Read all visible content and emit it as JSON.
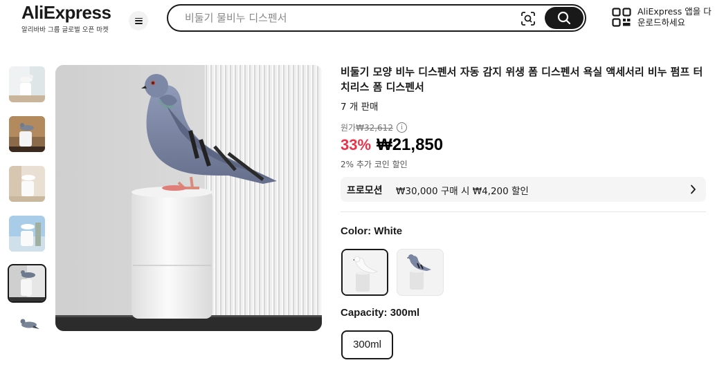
{
  "header": {
    "logo_text": "AliExpress",
    "logo_subtitle": "알리바바 그룹 글로벌 오픈 마켓",
    "search_placeholder": "비둘기 물비누 디스펜서",
    "app_promo_text": "AliExpress 앱을 다운로드하세요"
  },
  "product": {
    "title": "비둘기 모양 비누 디스펜서 자동 감지 위생 폼 디스펜서 욕실 액세서리 비누 펌프 터치리스 폼 디스펜서",
    "sold": "7 개 판매",
    "original_price_label": "원가",
    "original_price": "₩32,612",
    "info_icon_text": "i",
    "discount": "33%",
    "price": "₩21,850",
    "coin_text": "2% 추가 코인 할인",
    "promo_label": "프로모션",
    "promo_text": "₩30,000 구매 시 ₩4,200 할인",
    "color_label": "Color: White",
    "capacity_label": "Capacity: 300ml",
    "capacity_option": "300ml"
  },
  "icons": {
    "menu": "hamburger-icon",
    "camera": "camera-search-icon",
    "search": "search-icon",
    "qr": "qr-code-icon",
    "chevron": "chevron-right-icon"
  },
  "colors": {
    "accent_discount": "#e8334a",
    "dark": "#191919"
  }
}
